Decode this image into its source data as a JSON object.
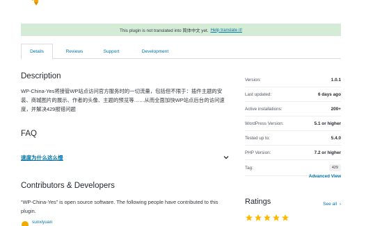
{
  "notice": {
    "text": "This plugin is not translated into 简体中文 yet.",
    "link": "Help translate it!"
  },
  "tabs": [
    {
      "label": "Details",
      "active": true
    },
    {
      "label": "Reviews",
      "active": false
    },
    {
      "label": "Support",
      "active": false
    },
    {
      "label": "Development",
      "active": false
    }
  ],
  "description": {
    "heading": "Description",
    "body": "WP-China-Yes将接管WP站点访问官方服务时的一切流量，包括但不限于：插件主题的安装、商城图片的展示、作者的头像、主题的预览等……从而全面加快WP站点后台的访问速度，并解决429报错问题"
  },
  "faq": {
    "heading": "FAQ",
    "question": "速度为什么这么慢"
  },
  "contributors": {
    "heading": "Contributors & Developers",
    "body": "“WP-China-Yes” is open source software. The following people have contributed to this plugin.",
    "name": "sunxiyuan"
  },
  "meta": {
    "rows": [
      {
        "label": "Version:",
        "value": "1.0.1"
      },
      {
        "label": "Last updated:",
        "value": "6 days ago"
      },
      {
        "label": "Active installations:",
        "value": "200+"
      },
      {
        "label": "WordPress Version:",
        "value": "5.1 or higher"
      },
      {
        "label": "Tested up to:",
        "value": "5.4.0"
      },
      {
        "label": "PHP Version:",
        "value": "7.2 or higher"
      }
    ],
    "tag_label": "Tag:",
    "tag_value": "429",
    "advanced_link": "Advanced View"
  },
  "ratings": {
    "title": "Ratings",
    "see_all": "See all",
    "see_all_icon": "›",
    "stars": 5
  },
  "colors": {
    "link": "#0073aa",
    "notice_bg": "#d4ecd6",
    "star": "#ffb900"
  },
  "icons": {
    "plugin_icon": "plugin-icon",
    "faq_toggle": "chevron-down-icon",
    "see_all_arrow": "chevron-right-icon",
    "star": "star-icon"
  }
}
